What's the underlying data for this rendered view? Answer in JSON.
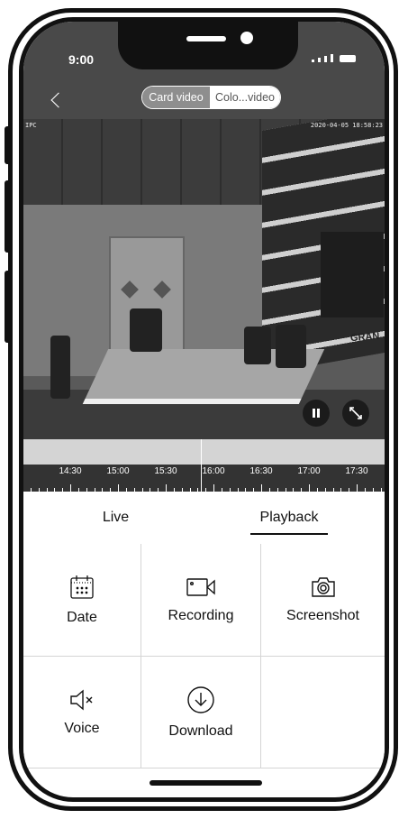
{
  "status_bar": {
    "time": "9:00"
  },
  "header": {
    "segments": [
      {
        "label": "Card video",
        "active": true
      },
      {
        "label": "Colo...video",
        "active": false
      }
    ]
  },
  "video": {
    "overlay_left": "IPC",
    "overlay_right": "2020-04-05 18:58:23",
    "sign_text": "GRAN"
  },
  "timeline": {
    "labels": [
      "14:30",
      "15:00",
      "15:30",
      "16:00",
      "16:30",
      "17:00",
      "17:30"
    ]
  },
  "tabs": [
    {
      "label": "Live",
      "active": false
    },
    {
      "label": "Playback",
      "active": true
    }
  ],
  "actions": [
    {
      "label": "Date",
      "icon": "calendar-icon"
    },
    {
      "label": "Recording",
      "icon": "video-camera-icon"
    },
    {
      "label": "Screenshot",
      "icon": "camera-icon"
    },
    {
      "label": "Voice",
      "icon": "speaker-mute-icon"
    },
    {
      "label": "Download",
      "icon": "download-icon"
    }
  ]
}
